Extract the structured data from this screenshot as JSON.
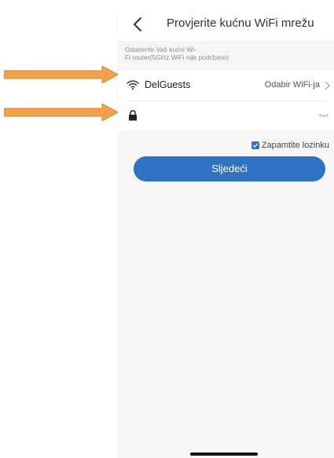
{
  "header": {
    "title": "Provjerite kućnu WiFi mrežu"
  },
  "hint": {
    "line1": "Odaberite Vaš kućni Wi-",
    "line2": "Fi router(5GHz WiFi nije podržano)"
  },
  "wifi_row": {
    "ssid": "DelGuests",
    "select_label": "Odabir WiFi-ja"
  },
  "password_row": {
    "value": "",
    "placeholder": ""
  },
  "remember": {
    "label": "Zapamtite lozinku",
    "checked": true
  },
  "next_button": {
    "label": "Sljedeći"
  },
  "colors": {
    "accent": "#2f72c4",
    "screen_bg": "#f6f6f6",
    "annotation_arrow": "#f0a24a"
  },
  "icons": [
    "chevron-left-icon",
    "wifi-icon",
    "chevron-right-icon",
    "lock-icon",
    "eye-closed-icon",
    "checkbox-checked-icon"
  ]
}
